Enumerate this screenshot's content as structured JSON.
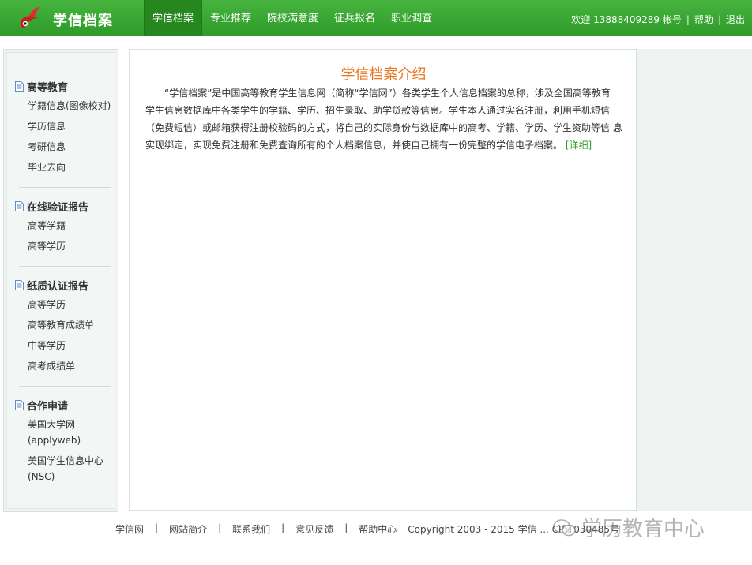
{
  "header": {
    "site_title": "学信档案",
    "nav": [
      {
        "label": "学信档案",
        "active": true
      },
      {
        "label": "专业推荐",
        "active": false
      },
      {
        "label": "院校满意度",
        "active": false
      },
      {
        "label": "征兵报名",
        "active": false
      },
      {
        "label": "职业调查",
        "active": false
      }
    ],
    "user": {
      "welcome": "欢迎 13888409289 帐号",
      "help": "帮助",
      "logout": "退出",
      "separator": "|"
    }
  },
  "sidebar": {
    "sections": [
      {
        "heading": "高等教育",
        "items": [
          "学籍信息(图像校对)",
          "学历信息",
          "考研信息",
          "毕业去向"
        ]
      },
      {
        "heading": "在线验证报告",
        "items": [
          "高等学籍",
          "高等学历"
        ]
      },
      {
        "heading": "纸质认证报告",
        "items": [
          "高等学历",
          "高等教育成绩单",
          "中等学历",
          "高考成绩单"
        ]
      },
      {
        "heading": "合作申请",
        "items": [
          "美国大学网(applyweb)",
          "美国学生信息中心(NSC)"
        ]
      }
    ]
  },
  "main": {
    "title": "学信档案介绍",
    "body": "“学信档案”是中国高等教育学生信息网（简称“学信网”）各类学生个人信息档案的总称，涉及全国高等教育 学生信息数据库中各类学生的学籍、学历、招生录取、助学贷款等信息。学生本人通过实名注册，利用手机短信 （免费短信）或邮箱获得注册校验码的方式，将自己的实际身份与数据库中的高考、学籍、学历、学生资助等信 息实现绑定，实现免费注册和免费查询所有的个人档案信息，并使自己拥有一份完整的学信电子档案。",
    "detail_link": "[详细]"
  },
  "footer": {
    "links": [
      "学信网",
      "网站简介",
      "联系我们",
      "意见反馈",
      "帮助中心"
    ],
    "separator": "|",
    "copyright": "Copyright 2003 - 2015  学信 ... CP证030485号"
  },
  "watermark": {
    "text": "学历教育中心",
    "icon": "wechat-icon"
  },
  "colors": {
    "header_green": "#2f9b2a",
    "title_orange": "#e87722",
    "link_green": "#2f9b2a"
  }
}
